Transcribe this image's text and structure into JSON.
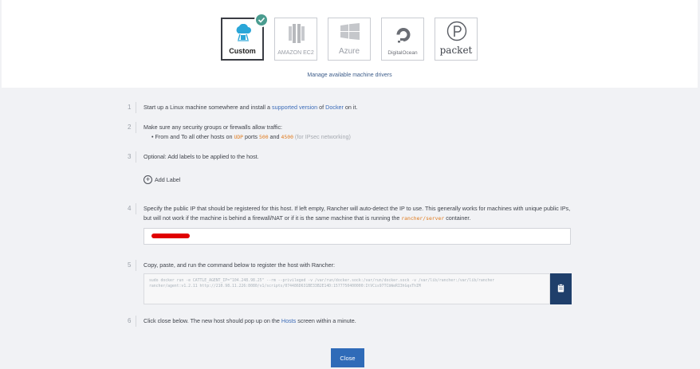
{
  "drivers": [
    {
      "name": "Custom",
      "icon": "cloud-drive-icon",
      "selected": true
    },
    {
      "name": "AMAZON EC2",
      "icon": "amazon-ec2-icon"
    },
    {
      "name": "Azure",
      "icon": "azure-icon"
    },
    {
      "name": "DigitalOcean",
      "icon": "digitalocean-icon"
    },
    {
      "name": "packet",
      "icon": "packet-icon"
    }
  ],
  "manage_link": "Manage available machine drivers",
  "steps": {
    "s1": {
      "num": "1",
      "pre": "Start up a Linux machine somewhere and install a ",
      "link1": "supported version",
      "mid": " of ",
      "link2": "Docker",
      "post": " on it."
    },
    "s2": {
      "num": "2",
      "text": "Make sure any security groups or firewalls allow traffic:",
      "bullet_pre": "From and To all other hosts on ",
      "udp": "UDP",
      "ports_word": " ports ",
      "port1": "500",
      "and": " and ",
      "port2": "4500",
      "note": " (for IPsec networking)"
    },
    "s3": {
      "num": "3",
      "text": "Optional: Add labels to be applied to the host.",
      "add_label": "Add Label"
    },
    "s4": {
      "num": "4",
      "text": "Specify the public IP that should be registered for this host. If left empty, Rancher will auto-detect the IP to use. This generally works for machines with unique public IPs, but will not work if the machine is behind a firewall/NAT or if it is the same machine that is running the ",
      "code": "rancher/server",
      "post": " container."
    },
    "s5": {
      "num": "5",
      "text": "Copy, paste, and run the command below to register the host with Rancher:",
      "command": "sudo docker run -e CATTLE_AGENT_IP=\"104.248.98.25\"  --rm --privileged -v /var/run/docker.sock:/var/run/docker.sock -v /var/lib/rancher:/var/lib/rancher rancher/agent:v1.2.11 http://210.98.11.226:8080/v1/scripts/074486D631BE33B2E14D:1577750400000:ItVCis97TCbWeRI3hGqxThIM"
    },
    "s6": {
      "num": "6",
      "pre": "Click close below. The new host should pop up on the ",
      "link": "Hosts",
      "post": " screen within a minute."
    }
  },
  "close_label": "Close",
  "colors": {
    "accent": "#2f6bb8",
    "check": "#4a9c8f",
    "copy_button": "#1f3f6b",
    "redaction": "#e00000"
  }
}
